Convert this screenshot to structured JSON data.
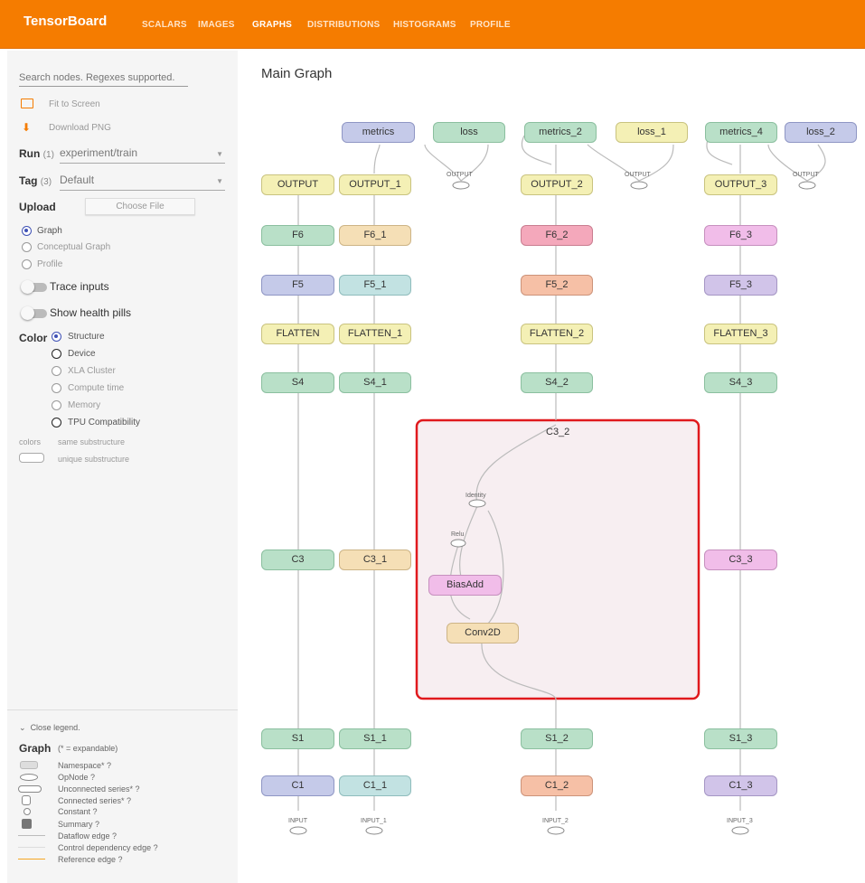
{
  "header": {
    "brand": "TensorBoard",
    "tabs": [
      "SCALARS",
      "IMAGES",
      "GRAPHS",
      "DISTRIBUTIONS",
      "HISTOGRAMS",
      "PROFILE"
    ],
    "active_tab": "GRAPHS"
  },
  "sidebar": {
    "search_placeholder": "Search nodes. Regexes supported.",
    "fit_to_screen": "Fit to Screen",
    "download_png": "Download PNG",
    "run_label": "Run",
    "run_count": "(1)",
    "run_value": "experiment/train",
    "tag_label": "Tag",
    "tag_count": "(3)",
    "tag_value": "Default",
    "upload_label": "Upload",
    "choose_file": "Choose File",
    "graph_types": [
      "Graph",
      "Conceptual Graph",
      "Profile"
    ],
    "trace_inputs": "Trace inputs",
    "show_health_pills": "Show health pills",
    "color_label": "Color",
    "color_options": [
      "Structure",
      "Device",
      "XLA Cluster",
      "Compute time",
      "Memory",
      "TPU Compatibility"
    ],
    "colors_caption": "colors",
    "same_substructure": "same substructure",
    "unique_substructure": "unique substructure"
  },
  "legend": {
    "close": "Close legend.",
    "title": "Graph",
    "expandable_note": "(* = expandable)",
    "items": [
      "Namespace* ?",
      "OpNode ?",
      "Unconnected series* ?",
      "Connected series* ?",
      "Constant ?",
      "Summary ?",
      "Dataflow edge ?",
      "Control dependency edge ?",
      "Reference edge ?"
    ]
  },
  "graph": {
    "title": "Main Graph",
    "nodes": {
      "metrics": "metrics",
      "loss": "loss",
      "metrics_2": "metrics_2",
      "loss_1": "loss_1",
      "metrics_4": "metrics_4",
      "loss_2": "loss_2",
      "output": "OUTPUT",
      "output_1": "OUTPUT_1",
      "output_2": "OUTPUT_2",
      "output_3": "OUTPUT_3",
      "f6": "F6",
      "f6_1": "F6_1",
      "f6_2": "F6_2",
      "f6_3": "F6_3",
      "f5": "F5",
      "f5_1": "F5_1",
      "f5_2": "F5_2",
      "f5_3": "F5_3",
      "flatten": "FLATTEN",
      "flatten_1": "FLATTEN_1",
      "flatten_2": "FLATTEN_2",
      "flatten_3": "FLATTEN_3",
      "s4": "S4",
      "s4_1": "S4_1",
      "s4_2": "S4_2",
      "s4_3": "S4_3",
      "c3": "C3",
      "c3_1": "C3_1",
      "c3_2": "C3_2",
      "c3_3": "C3_3",
      "biasadd": "BiasAdd",
      "conv2d": "Conv2D",
      "identity": "Identity",
      "relu": "Relu",
      "s1": "S1",
      "s1_1": "S1_1",
      "s1_2": "S1_2",
      "s1_3": "S1_3",
      "c1": "C1",
      "c1_1": "C1_1",
      "c1_2": "C1_2",
      "c1_3": "C1_3",
      "input": "INPUT",
      "input_1": "INPUT_1",
      "input_2": "INPUT_2",
      "input_3": "INPUT_3",
      "output_small": "OUTPUT"
    }
  },
  "colors": {
    "header_bg": "#f57c00",
    "highlight_border": "#e0191d",
    "highlight_fill": "#f7eef1",
    "accent": "#3f51b5"
  }
}
